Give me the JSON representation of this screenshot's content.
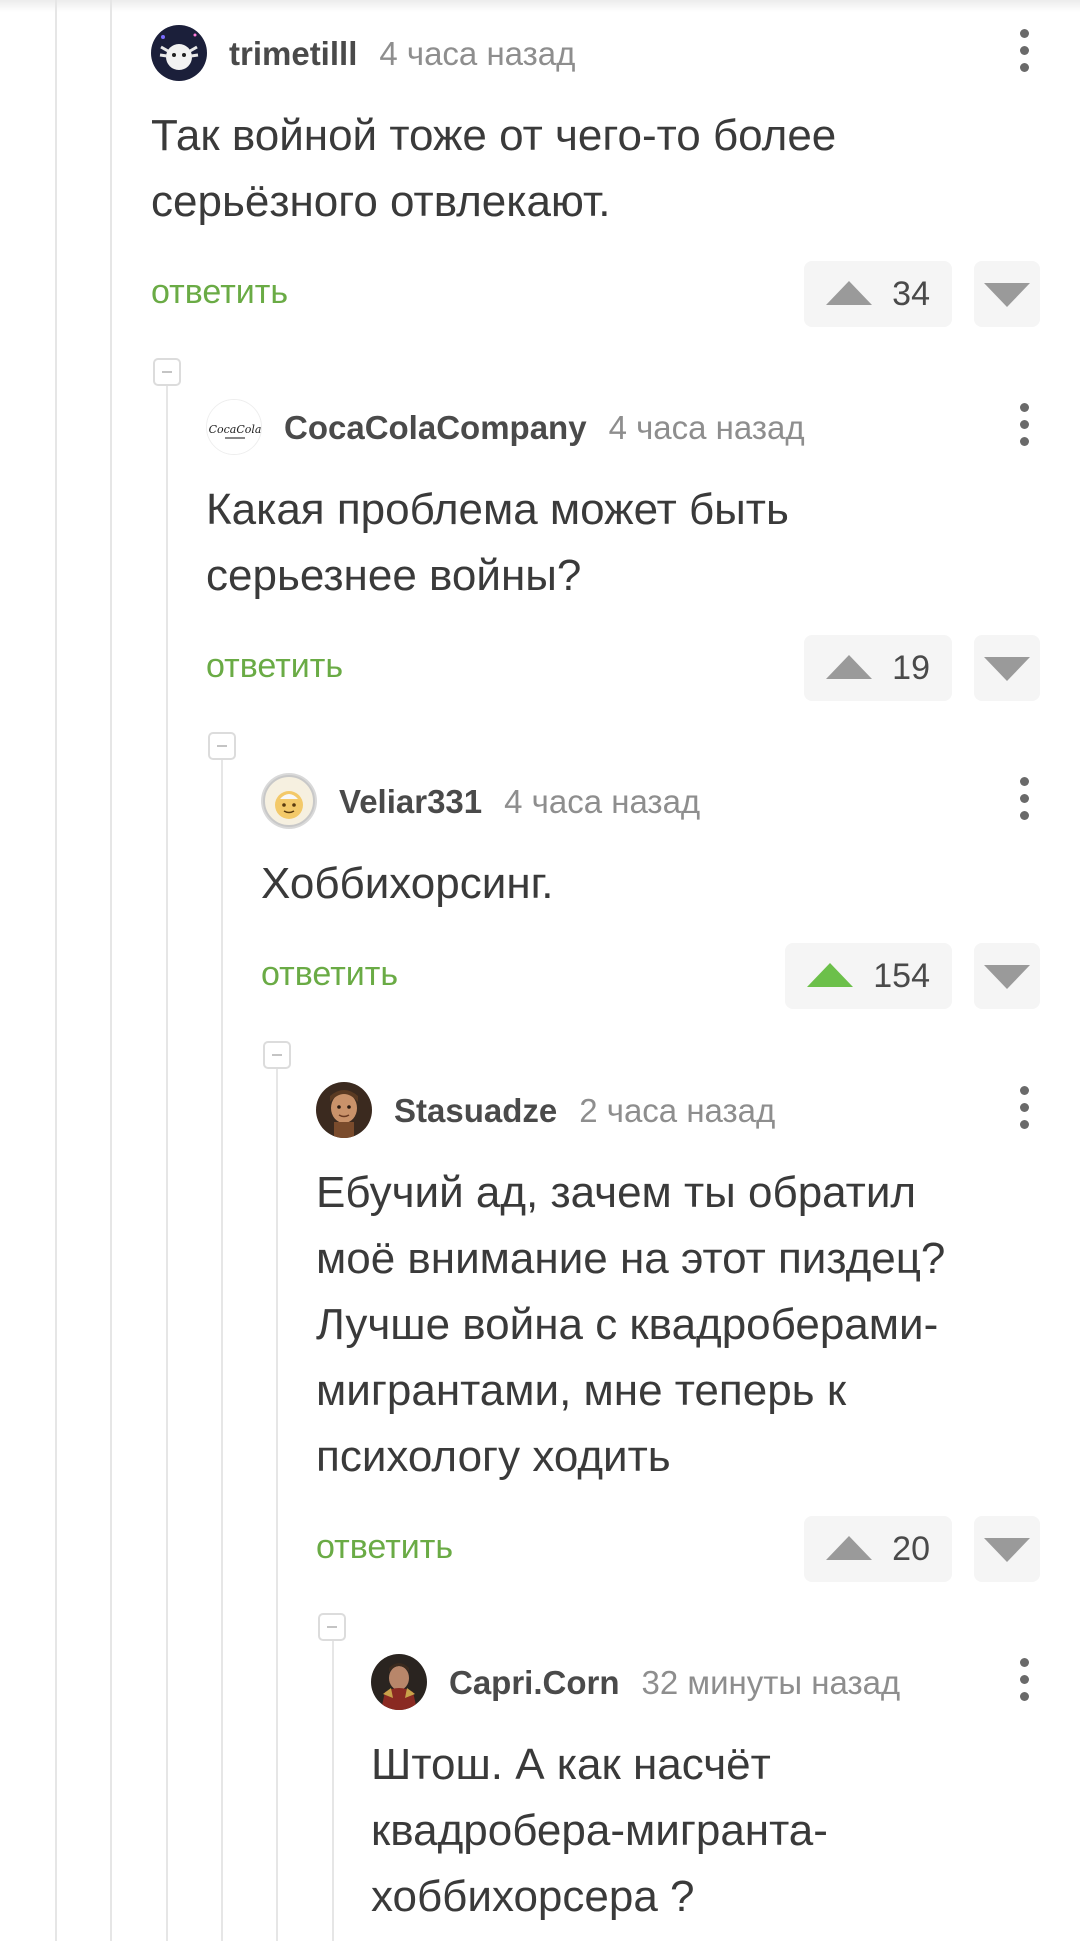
{
  "comments": [
    {
      "username": "trimetilll",
      "timestamp": "4 часа назад",
      "avatar": "axolotl-avatar",
      "text": "Так войной тоже от чего-то более\nсерьёзного отвлекают.",
      "reply_label": "ответить",
      "votes": "34",
      "upvoted": false
    },
    {
      "username": "CocaColaCompany",
      "timestamp": "4 часа назад",
      "avatar": "coca-cola-logo-avatar",
      "avatar_logo_text": "CocaCola",
      "text": "Какая проблема может быть\nсерьезнее войны?",
      "reply_label": "ответить",
      "votes": "19",
      "upvoted": false
    },
    {
      "username": "Veliar331",
      "timestamp": "4 часа назад",
      "avatar": "cartoon-face-avatar",
      "text": "Хоббихорсинг.",
      "reply_label": "ответить",
      "votes": "154",
      "upvoted": true
    },
    {
      "username": "Stasuadze",
      "timestamp": "2 часа назад",
      "avatar": "portrait-photo-avatar",
      "text": "Ебучий ад, зачем ты обратил\nмоё внимание на этот пиздец?\nЛучше война с квадроберами-\nмигрантами, мне теперь к\nпсихологу ходить",
      "reply_label": "ответить",
      "votes": "20",
      "upvoted": false
    },
    {
      "username": "Capri.Corn",
      "timestamp": "32 минуты назад",
      "avatar": "armored-character-avatar",
      "text": "Штош. А как насчёт\nквадробера-мигранта-\nхоббихорсера ?"
    }
  ],
  "colors": {
    "reply_link": "#6aab45",
    "upvote_active": "#6cc04a",
    "vote_inactive": "#9a9a9a",
    "thread_line": "#e6e6e6"
  },
  "icons": [
    "more-vertical-icon",
    "upvote-icon",
    "downvote-icon",
    "collapse-thread-icon"
  ]
}
